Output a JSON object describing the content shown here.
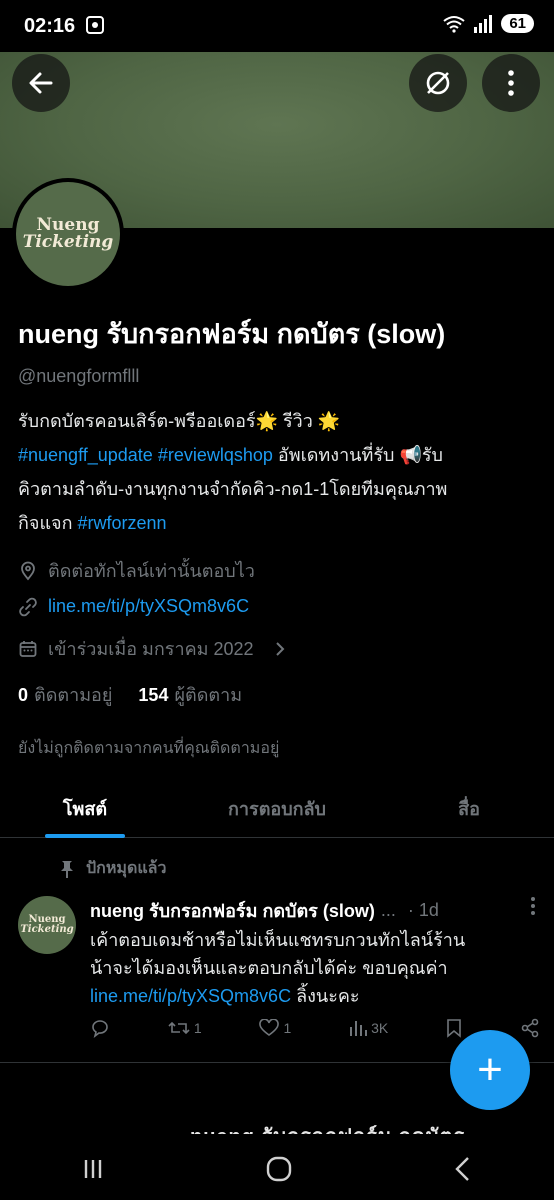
{
  "status_bar": {
    "time": "02:16",
    "battery": "61"
  },
  "profile": {
    "logo_text_1": "Nueng",
    "logo_text_2": "Ticketing",
    "name": "nueng รับกรอกฟอร์ม กดบัตร (slow)",
    "handle": "@nuengformflll",
    "bio_line1": "รับกดบัตรคอนเสิร์ต-พรีออเดอร์🌟 รีวิว 🌟",
    "bio_tag1": "#nuengff_update",
    "bio_tag2": "#reviewlqshop",
    "bio_line2_rest": " อัพเดทงานที่รับ 📢รับ",
    "bio_line3": "คิวตามลำดับ-งานทุกงานจำกัดคิว-กด1-1โดยทีมคุณภาพ",
    "bio_line4": "กิจแจก ",
    "bio_tag3": "#rwforzenn",
    "location": "ติดต่อทักไลน์เท่านั้นตอบไว",
    "url": "line.me/ti/p/tyXSQm8v6C",
    "joined": "เข้าร่วมเมื่อ มกราคม 2022",
    "following_count": "0",
    "following_label": "ติดตามอยู่",
    "followers_count": "154",
    "followers_label": "ผู้ติดตาม",
    "not_followed": "ยังไม่ถูกติดตามจากคนที่คุณติดตามอยู่"
  },
  "tabs": [
    {
      "label": "โพสต์"
    },
    {
      "label": "การตอบกลับ"
    },
    {
      "label": "สื่อ"
    }
  ],
  "pinned_tweet": {
    "pinned_label": "ปักหมุดแล้ว",
    "name": "nueng รับกรอกฟอร์ม กดบัตร (slow)",
    "dots": "...",
    "time": "· 1d",
    "text_line1": "เค้าตอบเดมช้าหรือไม่เห็นแชทรบกวนทักไลน์ร้าน",
    "text_line2": "น้าจะได้มองเห็นและตอบกลับได้ค่ะ ขอบคุณค่า",
    "text_link": "line.me/ti/p/tyXSQm8v6C",
    "text_after_link": " ลิ้งนะคะ",
    "retweets": "1",
    "likes": "1",
    "views": "3K"
  },
  "next_tweet_preview": "nueng รับกรอกฟอร์ม กดบัตร",
  "fab_label": "+"
}
